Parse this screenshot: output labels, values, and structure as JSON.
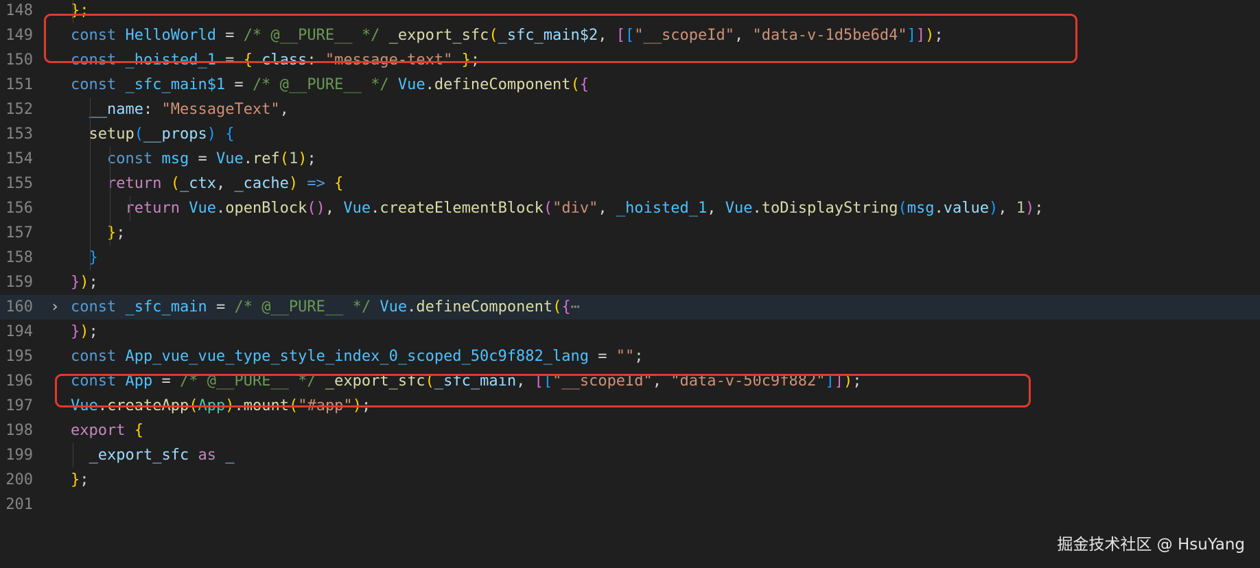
{
  "editor": {
    "lines": [
      {
        "num": "148",
        "tokens": [
          {
            "t": "};",
            "c": "b1"
          }
        ]
      },
      {
        "num": "149",
        "tokens": [
          {
            "t": "const ",
            "c": "kw"
          },
          {
            "t": "HelloWorld",
            "c": "cst"
          },
          {
            "t": " = ",
            "c": "p"
          },
          {
            "t": "/* @__PURE__ */",
            "c": "cm"
          },
          {
            "t": " ",
            "c": "p"
          },
          {
            "t": "_export_sfc",
            "c": "fn"
          },
          {
            "t": "(",
            "c": "b1"
          },
          {
            "t": "_sfc_main$2",
            "c": "id"
          },
          {
            "t": ", ",
            "c": "p"
          },
          {
            "t": "[",
            "c": "b2"
          },
          {
            "t": "[",
            "c": "b3"
          },
          {
            "t": "\"__scopeId\"",
            "c": "str"
          },
          {
            "t": ", ",
            "c": "p"
          },
          {
            "t": "\"data-v-1d5be6d4\"",
            "c": "str"
          },
          {
            "t": "]",
            "c": "b3"
          },
          {
            "t": "]",
            "c": "b2"
          },
          {
            "t": ")",
            "c": "b1"
          },
          {
            "t": ";",
            "c": "p"
          }
        ]
      },
      {
        "num": "150",
        "tokens": [
          {
            "t": "const ",
            "c": "kw"
          },
          {
            "t": "_hoisted_1",
            "c": "cst"
          },
          {
            "t": " = ",
            "c": "p"
          },
          {
            "t": "{ ",
            "c": "b1"
          },
          {
            "t": "class",
            "c": "id"
          },
          {
            "t": ": ",
            "c": "p"
          },
          {
            "t": "\"message-text\"",
            "c": "str"
          },
          {
            "t": " }",
            "c": "b1"
          },
          {
            "t": ";",
            "c": "p"
          }
        ]
      },
      {
        "num": "151",
        "tokens": [
          {
            "t": "const ",
            "c": "kw"
          },
          {
            "t": "_sfc_main$1",
            "c": "cst"
          },
          {
            "t": " = ",
            "c": "p"
          },
          {
            "t": "/* @__PURE__ */",
            "c": "cm"
          },
          {
            "t": " ",
            "c": "p"
          },
          {
            "t": "Vue",
            "c": "cst"
          },
          {
            "t": ".",
            "c": "p"
          },
          {
            "t": "defineComponent",
            "c": "fn"
          },
          {
            "t": "(",
            "c": "b1"
          },
          {
            "t": "{",
            "c": "b2"
          }
        ]
      },
      {
        "num": "152",
        "tokens": [
          {
            "t": "  ",
            "c": "p"
          },
          {
            "t": "__name",
            "c": "id"
          },
          {
            "t": ": ",
            "c": "p"
          },
          {
            "t": "\"MessageText\"",
            "c": "str"
          },
          {
            "t": ",",
            "c": "p"
          }
        ]
      },
      {
        "num": "153",
        "tokens": [
          {
            "t": "  ",
            "c": "p"
          },
          {
            "t": "setup",
            "c": "fn"
          },
          {
            "t": "(",
            "c": "b3"
          },
          {
            "t": "__props",
            "c": "id"
          },
          {
            "t": ") ",
            "c": "b3"
          },
          {
            "t": "{",
            "c": "b3"
          }
        ]
      },
      {
        "num": "154",
        "tokens": [
          {
            "t": "    ",
            "c": "p"
          },
          {
            "t": "const ",
            "c": "kw"
          },
          {
            "t": "msg",
            "c": "cst"
          },
          {
            "t": " = ",
            "c": "p"
          },
          {
            "t": "Vue",
            "c": "cst"
          },
          {
            "t": ".",
            "c": "p"
          },
          {
            "t": "ref",
            "c": "fn"
          },
          {
            "t": "(",
            "c": "b1"
          },
          {
            "t": "1",
            "c": "num"
          },
          {
            "t": ")",
            "c": "b1"
          },
          {
            "t": ";",
            "c": "p"
          }
        ]
      },
      {
        "num": "155",
        "tokens": [
          {
            "t": "    ",
            "c": "p"
          },
          {
            "t": "return ",
            "c": "ctl"
          },
          {
            "t": "(",
            "c": "b1"
          },
          {
            "t": "_ctx",
            "c": "id"
          },
          {
            "t": ", ",
            "c": "p"
          },
          {
            "t": "_cache",
            "c": "id"
          },
          {
            "t": ")",
            "c": "b1"
          },
          {
            "t": " ",
            "c": "p"
          },
          {
            "t": "=>",
            "c": "kw"
          },
          {
            "t": " ",
            "c": "p"
          },
          {
            "t": "{",
            "c": "b1"
          }
        ]
      },
      {
        "num": "156",
        "tokens": [
          {
            "t": "      ",
            "c": "p"
          },
          {
            "t": "return ",
            "c": "ctl"
          },
          {
            "t": "Vue",
            "c": "cst"
          },
          {
            "t": ".",
            "c": "p"
          },
          {
            "t": "openBlock",
            "c": "fn"
          },
          {
            "t": "()",
            "c": "b2"
          },
          {
            "t": ", ",
            "c": "p"
          },
          {
            "t": "Vue",
            "c": "cst"
          },
          {
            "t": ".",
            "c": "p"
          },
          {
            "t": "createElementBlock",
            "c": "fn"
          },
          {
            "t": "(",
            "c": "b2"
          },
          {
            "t": "\"div\"",
            "c": "str"
          },
          {
            "t": ", ",
            "c": "p"
          },
          {
            "t": "_hoisted_1",
            "c": "cst"
          },
          {
            "t": ", ",
            "c": "p"
          },
          {
            "t": "Vue",
            "c": "cst"
          },
          {
            "t": ".",
            "c": "p"
          },
          {
            "t": "toDisplayString",
            "c": "fn"
          },
          {
            "t": "(",
            "c": "b3"
          },
          {
            "t": "msg",
            "c": "cst"
          },
          {
            "t": ".",
            "c": "p"
          },
          {
            "t": "value",
            "c": "id"
          },
          {
            "t": ")",
            "c": "b3"
          },
          {
            "t": ", ",
            "c": "p"
          },
          {
            "t": "1",
            "c": "num"
          },
          {
            "t": ")",
            "c": "b2"
          },
          {
            "t": ";",
            "c": "p"
          }
        ]
      },
      {
        "num": "157",
        "tokens": [
          {
            "t": "    ",
            "c": "p"
          },
          {
            "t": "}",
            "c": "b1"
          },
          {
            "t": ";",
            "c": "p"
          }
        ]
      },
      {
        "num": "158",
        "tokens": [
          {
            "t": "  ",
            "c": "p"
          },
          {
            "t": "}",
            "c": "b3"
          }
        ]
      },
      {
        "num": "159",
        "tokens": [
          {
            "t": "}",
            "c": "b2"
          },
          {
            "t": ")",
            "c": "b1"
          },
          {
            "t": ";",
            "c": "p"
          }
        ]
      },
      {
        "num": "160",
        "folded": true,
        "highlight": true,
        "tokens": [
          {
            "t": "const ",
            "c": "kw"
          },
          {
            "t": "_sfc_main",
            "c": "cst"
          },
          {
            "t": " = ",
            "c": "p"
          },
          {
            "t": "/* @__PURE__ */",
            "c": "cm"
          },
          {
            "t": " ",
            "c": "p"
          },
          {
            "t": "Vue",
            "c": "cst"
          },
          {
            "t": ".",
            "c": "p"
          },
          {
            "t": "defineComponent",
            "c": "fn"
          },
          {
            "t": "(",
            "c": "b1"
          },
          {
            "t": "{",
            "c": "b2"
          },
          {
            "t": "⋯",
            "c": "dim"
          }
        ]
      },
      {
        "num": "194",
        "tokens": [
          {
            "t": "}",
            "c": "b2"
          },
          {
            "t": ")",
            "c": "b1"
          },
          {
            "t": ";",
            "c": "p"
          }
        ]
      },
      {
        "num": "195",
        "tokens": [
          {
            "t": "const ",
            "c": "kw"
          },
          {
            "t": "App_vue_vue_type_style_index_0_scoped_50c9f882_lang",
            "c": "cst"
          },
          {
            "t": " = ",
            "c": "p"
          },
          {
            "t": "\"\"",
            "c": "str"
          },
          {
            "t": ";",
            "c": "p"
          }
        ]
      },
      {
        "num": "196",
        "tokens": [
          {
            "t": "const ",
            "c": "kw"
          },
          {
            "t": "App",
            "c": "cst"
          },
          {
            "t": " = ",
            "c": "p"
          },
          {
            "t": "/* @__PURE__ */",
            "c": "cm"
          },
          {
            "t": " ",
            "c": "p"
          },
          {
            "t": "_export_sfc",
            "c": "fn"
          },
          {
            "t": "(",
            "c": "b1"
          },
          {
            "t": "_sfc_main",
            "c": "id"
          },
          {
            "t": ", ",
            "c": "p"
          },
          {
            "t": "[",
            "c": "b2"
          },
          {
            "t": "[",
            "c": "b3"
          },
          {
            "t": "\"__scopeId\"",
            "c": "str"
          },
          {
            "t": ", ",
            "c": "p"
          },
          {
            "t": "\"data-v-50c9f882\"",
            "c": "str"
          },
          {
            "t": "]",
            "c": "b3"
          },
          {
            "t": "]",
            "c": "b2"
          },
          {
            "t": ")",
            "c": "b1"
          },
          {
            "t": ";",
            "c": "p"
          }
        ]
      },
      {
        "num": "197",
        "tokens": [
          {
            "t": "Vue",
            "c": "cst"
          },
          {
            "t": ".",
            "c": "p"
          },
          {
            "t": "createApp",
            "c": "fn"
          },
          {
            "t": "(",
            "c": "b1"
          },
          {
            "t": "App",
            "c": "cls"
          },
          {
            "t": ")",
            "c": "b1"
          },
          {
            "t": ".",
            "c": "p"
          },
          {
            "t": "mount",
            "c": "fn"
          },
          {
            "t": "(",
            "c": "b1"
          },
          {
            "t": "\"#app\"",
            "c": "str"
          },
          {
            "t": ")",
            "c": "b1"
          },
          {
            "t": ";",
            "c": "p"
          }
        ]
      },
      {
        "num": "198",
        "tokens": [
          {
            "t": "export ",
            "c": "ctl"
          },
          {
            "t": "{",
            "c": "b1"
          }
        ]
      },
      {
        "num": "199",
        "tokens": [
          {
            "t": "  ",
            "c": "p"
          },
          {
            "t": "_export_sfc",
            "c": "id"
          },
          {
            "t": " as ",
            "c": "ctl"
          },
          {
            "t": "_",
            "c": "id"
          }
        ]
      },
      {
        "num": "200",
        "tokens": [
          {
            "t": "}",
            "c": "b1"
          },
          {
            "t": ";",
            "c": "p"
          }
        ]
      },
      {
        "num": "201",
        "tokens": []
      }
    ],
    "highlight_boxes": [
      "149",
      "196"
    ]
  },
  "watermark": "掘金技术社区 @ HsuYang",
  "colors": {
    "background": "#1f1f1f",
    "line_number": "#858585",
    "highlight_box": "#e03a2e",
    "keyword": "#569cd6",
    "string": "#ce9178",
    "comment": "#6a9955",
    "function": "#dcdcaa"
  }
}
